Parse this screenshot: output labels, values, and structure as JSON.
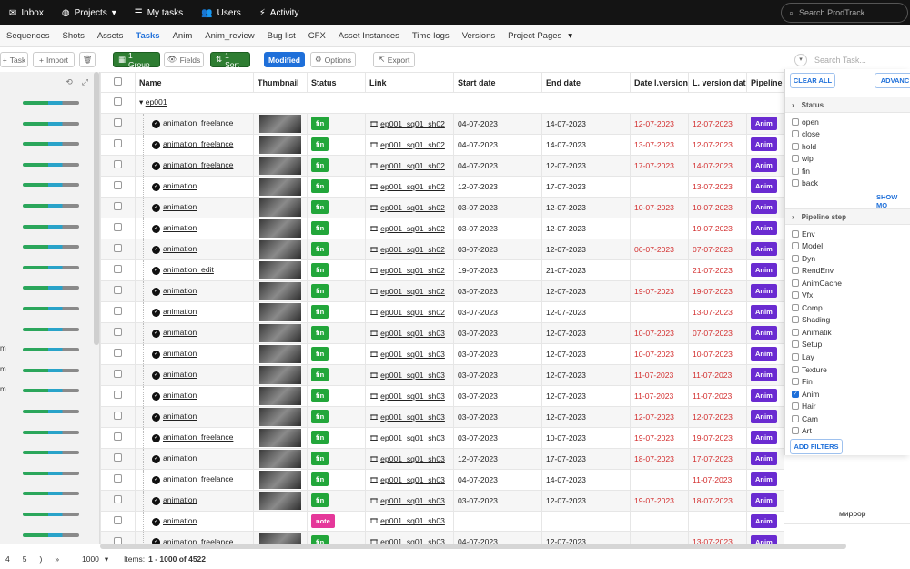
{
  "topbar": {
    "nav": [
      {
        "icon": "inbox-icon",
        "glyph": "✉",
        "label": "Inbox"
      },
      {
        "icon": "globe-icon",
        "glyph": "◍",
        "label": "Projects",
        "dropdown": true
      },
      {
        "icon": "list-icon",
        "glyph": "☰",
        "label": "My tasks"
      },
      {
        "icon": "users-icon",
        "glyph": "👥",
        "label": "Users"
      },
      {
        "icon": "bolt-icon",
        "glyph": "⚡",
        "label": "Activity"
      }
    ],
    "search_placeholder": "Search ProdTrack"
  },
  "tabs": [
    "Sequences",
    "Shots",
    "Assets",
    "Tasks",
    "Anim",
    "Anim_review",
    "Bug list",
    "CFX",
    "Asset Instances",
    "Time logs",
    "Versions",
    "Project Pages"
  ],
  "active_tab": "Tasks",
  "toolbar": {
    "task": "Task",
    "import": "Import",
    "group": "1 Group",
    "fields": "Fields",
    "sort": "1 Sort",
    "modified": "Modified",
    "options": "Options",
    "export": "Export",
    "search_placeholder": "Search Task..."
  },
  "left_panel": {
    "labels": [
      "",
      "",
      "",
      "",
      "",
      "",
      "",
      "",
      "",
      "",
      "",
      "",
      "m",
      "m",
      "m",
      "",
      "",
      "",
      "",
      "",
      "",
      "",
      ""
    ]
  },
  "grid": {
    "columns": [
      "",
      "Name",
      "Thumbnail",
      "Status",
      "Link",
      "Start date",
      "End date",
      "Date l.version",
      "L. version dat",
      "Pipeline"
    ],
    "group_label": "ep001",
    "rows": [
      {
        "name": "animation_freelance",
        "status": "fin",
        "link": "ep001_sq01_sh02",
        "start": "04-07-2023",
        "end": "14-07-2023",
        "dlv": "12-07-2023",
        "lvd": "12-07-2023",
        "pipe": "Anim",
        "thumb": true
      },
      {
        "name": "animation_freelance",
        "status": "fin",
        "link": "ep001_sq01_sh02",
        "start": "04-07-2023",
        "end": "14-07-2023",
        "dlv": "13-07-2023",
        "lvd": "12-07-2023",
        "pipe": "Anim",
        "thumb": true
      },
      {
        "name": "animation_freelance",
        "status": "fin",
        "link": "ep001_sq01_sh02",
        "start": "04-07-2023",
        "end": "12-07-2023",
        "dlv": "17-07-2023",
        "lvd": "14-07-2023",
        "pipe": "Anim",
        "thumb": true
      },
      {
        "name": "animation",
        "status": "fin",
        "link": "ep001_sq01_sh02",
        "start": "12-07-2023",
        "end": "17-07-2023",
        "dlv": "",
        "lvd": "13-07-2023",
        "pipe": "Anim",
        "thumb": true
      },
      {
        "name": "animation",
        "status": "fin",
        "link": "ep001_sq01_sh02",
        "start": "03-07-2023",
        "end": "12-07-2023",
        "dlv": "10-07-2023",
        "lvd": "10-07-2023",
        "pipe": "Anim",
        "thumb": true
      },
      {
        "name": "animation",
        "status": "fin",
        "link": "ep001_sq01_sh02",
        "start": "03-07-2023",
        "end": "12-07-2023",
        "dlv": "",
        "lvd": "19-07-2023",
        "pipe": "Anim",
        "thumb": true
      },
      {
        "name": "animation",
        "status": "fin",
        "link": "ep001_sq01_sh02",
        "start": "03-07-2023",
        "end": "12-07-2023",
        "dlv": "06-07-2023",
        "lvd": "07-07-2023",
        "pipe": "Anim",
        "thumb": true
      },
      {
        "name": "animation_edit",
        "status": "fin",
        "link": "ep001_sq01_sh02",
        "start": "19-07-2023",
        "end": "21-07-2023",
        "dlv": "",
        "lvd": "21-07-2023",
        "pipe": "Anim",
        "thumb": true
      },
      {
        "name": "animation",
        "status": "fin",
        "link": "ep001_sq01_sh02",
        "start": "03-07-2023",
        "end": "12-07-2023",
        "dlv": "19-07-2023",
        "lvd": "19-07-2023",
        "pipe": "Anim",
        "thumb": true
      },
      {
        "name": "animation",
        "status": "fin",
        "link": "ep001_sq01_sh02",
        "start": "03-07-2023",
        "end": "12-07-2023",
        "dlv": "",
        "lvd": "13-07-2023",
        "pipe": "Anim",
        "thumb": true
      },
      {
        "name": "animation",
        "status": "fin",
        "link": "ep001_sq01_sh03",
        "start": "03-07-2023",
        "end": "12-07-2023",
        "dlv": "10-07-2023",
        "lvd": "07-07-2023",
        "pipe": "Anim",
        "thumb": true
      },
      {
        "name": "animation",
        "status": "fin",
        "link": "ep001_sq01_sh03",
        "start": "03-07-2023",
        "end": "12-07-2023",
        "dlv": "10-07-2023",
        "lvd": "10-07-2023",
        "pipe": "Anim",
        "thumb": true
      },
      {
        "name": "animation",
        "status": "fin",
        "link": "ep001_sq01_sh03",
        "start": "03-07-2023",
        "end": "12-07-2023",
        "dlv": "11-07-2023",
        "lvd": "11-07-2023",
        "pipe": "Anim",
        "thumb": true
      },
      {
        "name": "animation",
        "status": "fin",
        "link": "ep001_sq01_sh03",
        "start": "03-07-2023",
        "end": "12-07-2023",
        "dlv": "11-07-2023",
        "lvd": "11-07-2023",
        "pipe": "Anim",
        "thumb": true
      },
      {
        "name": "animation",
        "status": "fin",
        "link": "ep001_sq01_sh03",
        "start": "03-07-2023",
        "end": "12-07-2023",
        "dlv": "12-07-2023",
        "lvd": "12-07-2023",
        "pipe": "Anim",
        "thumb": true
      },
      {
        "name": "animation_freelance",
        "status": "fin",
        "link": "ep001_sq01_sh03",
        "start": "03-07-2023",
        "end": "10-07-2023",
        "dlv": "19-07-2023",
        "lvd": "19-07-2023",
        "pipe": "Anim",
        "thumb": true
      },
      {
        "name": "animation",
        "status": "fin",
        "link": "ep001_sq01_sh03",
        "start": "12-07-2023",
        "end": "17-07-2023",
        "dlv": "18-07-2023",
        "lvd": "17-07-2023",
        "pipe": "Anim",
        "thumb": true
      },
      {
        "name": "animation_freelance",
        "status": "fin",
        "link": "ep001_sq01_sh03",
        "start": "04-07-2023",
        "end": "14-07-2023",
        "dlv": "",
        "lvd": "11-07-2023",
        "pipe": "Anim",
        "thumb": true
      },
      {
        "name": "animation",
        "status": "fin",
        "link": "ep001_sq01_sh03",
        "start": "03-07-2023",
        "end": "12-07-2023",
        "dlv": "19-07-2023",
        "lvd": "18-07-2023",
        "pipe": "Anim",
        "thumb": true
      },
      {
        "name": "animation",
        "status": "note",
        "link": "ep001_sq01_sh03",
        "start": "",
        "end": "",
        "dlv": "",
        "lvd": "",
        "pipe": "Anim",
        "thumb": false,
        "extra": "миррор"
      },
      {
        "name": "animation_freelance",
        "status": "fin",
        "link": "ep001_sq01_sh03",
        "start": "04-07-2023",
        "end": "12-07-2023",
        "dlv": "",
        "lvd": "13-07-2023",
        "pipe": "Anim",
        "thumb": true
      }
    ]
  },
  "filter_panel": {
    "clear_all": "CLEAR ALL",
    "advanced": "ADVANC",
    "status_title": "Status",
    "status_items": [
      {
        "label": "open",
        "checked": false
      },
      {
        "label": "close",
        "checked": false
      },
      {
        "label": "hold",
        "checked": false
      },
      {
        "label": "wip",
        "checked": false
      },
      {
        "label": "fin",
        "checked": false
      },
      {
        "label": "back",
        "checked": false
      }
    ],
    "show_more": "SHOW MO",
    "pipeline_title": "Pipeline step",
    "pipeline_items": [
      {
        "label": "Env",
        "checked": false
      },
      {
        "label": "Model",
        "checked": false
      },
      {
        "label": "Dyn",
        "checked": false
      },
      {
        "label": "RendEnv",
        "checked": false
      },
      {
        "label": "AnimCache",
        "checked": false
      },
      {
        "label": "Vfx",
        "checked": false
      },
      {
        "label": "Comp",
        "checked": false
      },
      {
        "label": "Shading",
        "checked": false
      },
      {
        "label": "Animatik",
        "checked": false
      },
      {
        "label": "Setup",
        "checked": false
      },
      {
        "label": "Lay",
        "checked": false
      },
      {
        "label": "Texture",
        "checked": false
      },
      {
        "label": "Fin",
        "checked": false
      },
      {
        "label": "Anim",
        "checked": true
      },
      {
        "label": "Hair",
        "checked": false
      },
      {
        "label": "Cam",
        "checked": false
      },
      {
        "label": "Art",
        "checked": false
      }
    ],
    "add_filters": "ADD FILTERS"
  },
  "footer": {
    "pages": [
      "4",
      "5",
      ")",
      "»"
    ],
    "page_size": "1000",
    "items_label": "Items:",
    "items_value": "1 - 1000 of 4522"
  },
  "colors": {
    "fin": "#22a63a",
    "note": "#e5389a",
    "pipeline": "#6a2bd1",
    "accent": "#1e6fd9",
    "late": "#d32f2f"
  }
}
